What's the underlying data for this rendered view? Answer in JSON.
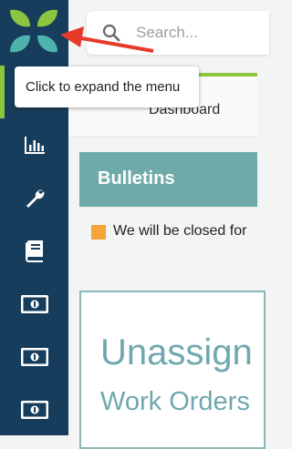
{
  "search": {
    "placeholder": "Search..."
  },
  "tooltip": {
    "text": "Click to expand the menu"
  },
  "dashboard": {
    "label": "Dashboard"
  },
  "bulletins": {
    "title": "Bulletins",
    "item": "We will be closed for"
  },
  "card": {
    "title": "Unassign",
    "subtitle": "Work Orders"
  },
  "sidebar": {
    "items": [
      {
        "icon": "bar-chart-icon"
      },
      {
        "icon": "wrench-icon"
      },
      {
        "icon": "book-icon"
      },
      {
        "icon": "money-icon"
      },
      {
        "icon": "money-icon"
      },
      {
        "icon": "money-icon"
      }
    ]
  },
  "colors": {
    "sidebar": "#173d5c",
    "accent_green": "#8cc63f",
    "teal": "#6eaaa9",
    "bullet_orange": "#f4a43a",
    "arrow_red": "#e53a2a"
  }
}
